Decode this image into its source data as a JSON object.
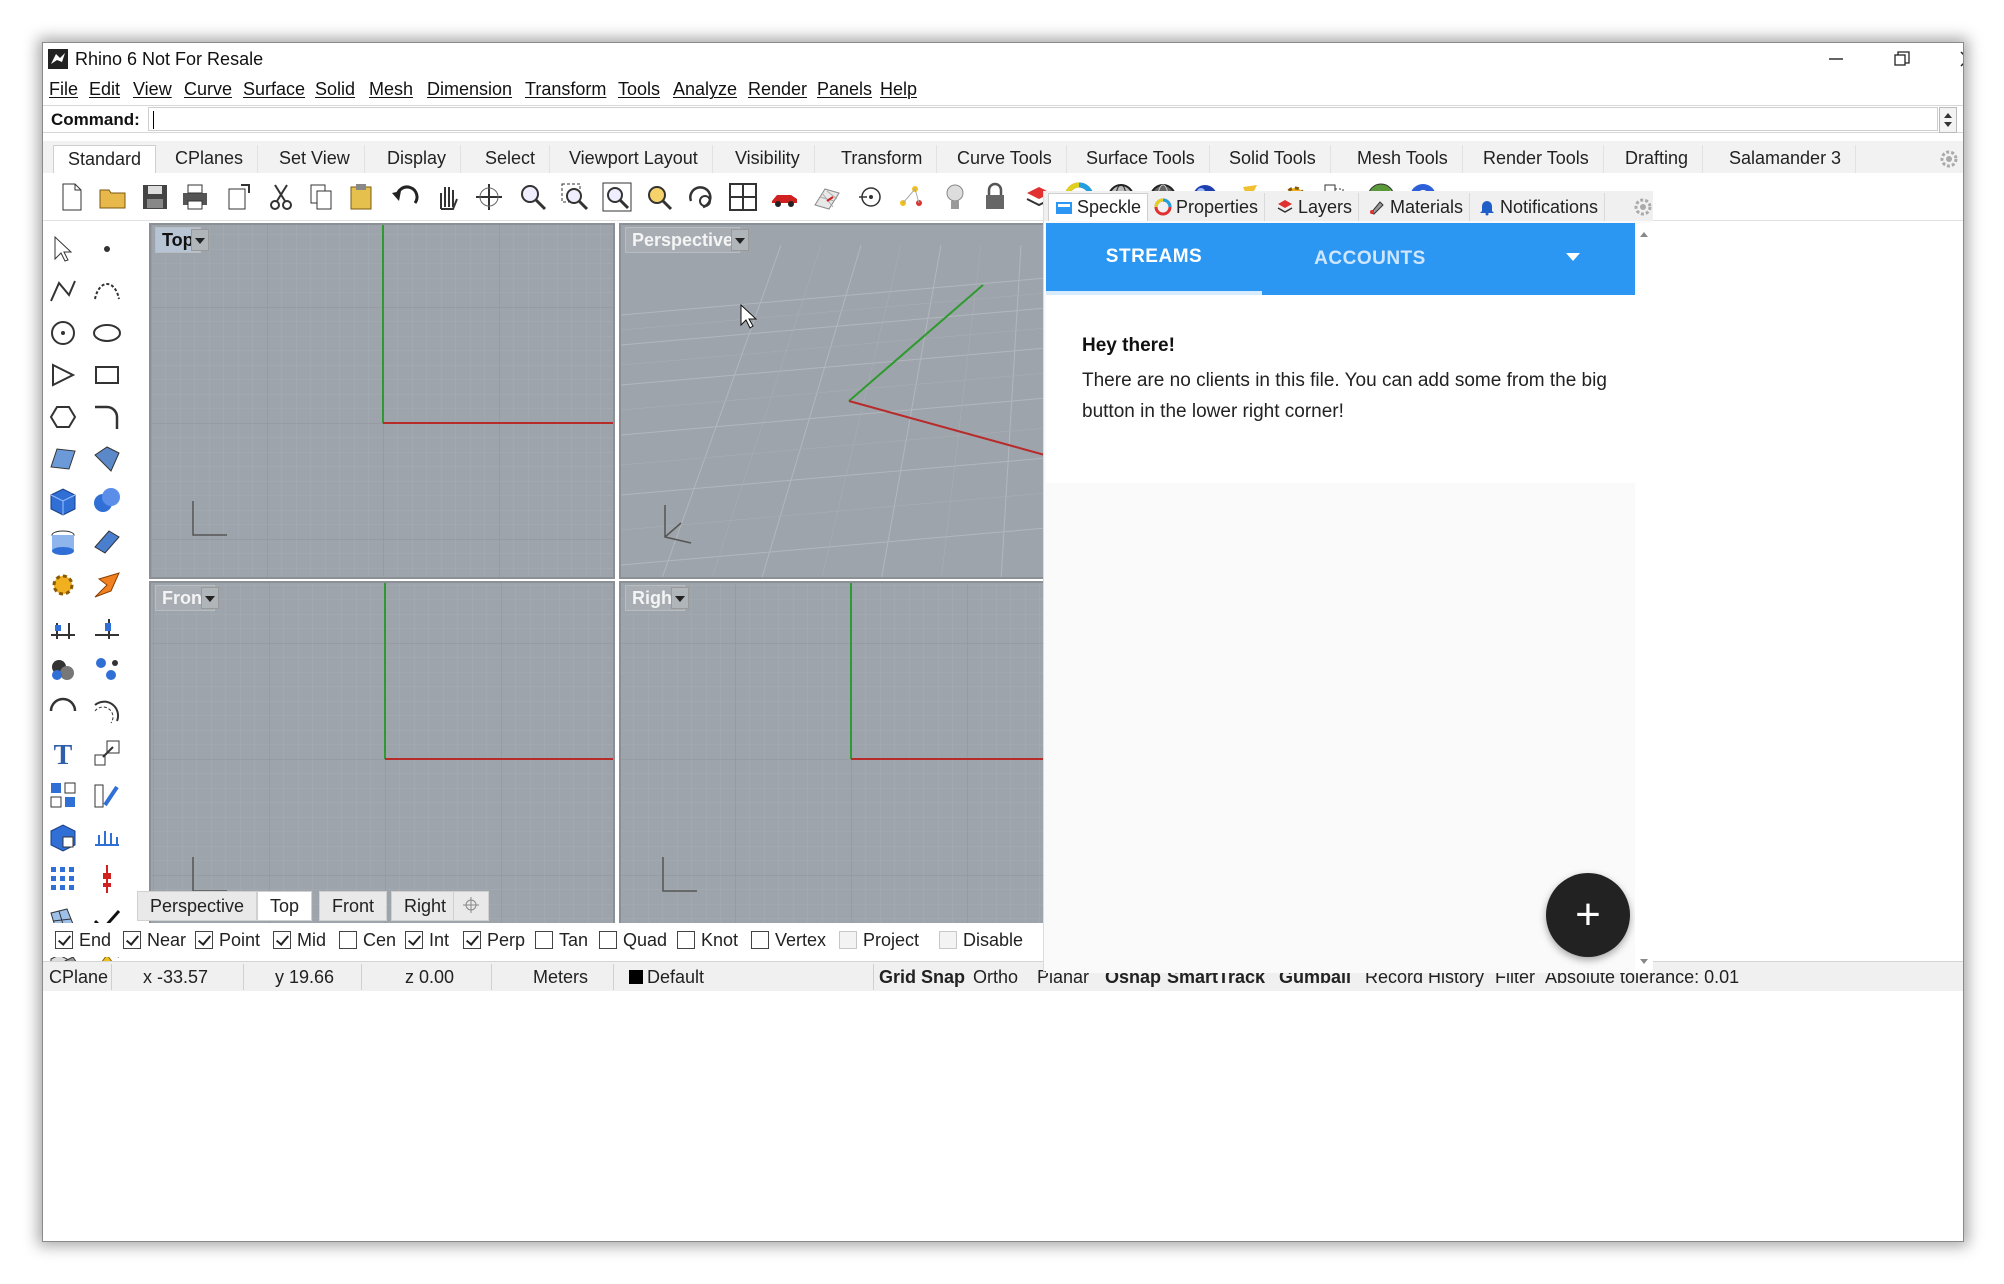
{
  "app": {
    "title": "Rhino 6 Not For Resale"
  },
  "menu": [
    "File",
    "Edit",
    "View",
    "Curve",
    "Surface",
    "Solid",
    "Mesh",
    "Dimension",
    "Transform",
    "Tools",
    "Analyze",
    "Render",
    "Panels",
    "Help"
  ],
  "command": {
    "label": "Command:",
    "value": ""
  },
  "toolbar_tabs": [
    "Standard",
    "CPlanes",
    "Set View",
    "Display",
    "Select",
    "Viewport Layout",
    "Visibility",
    "Transform",
    "Curve Tools",
    "Surface Tools",
    "Solid Tools",
    "Mesh Tools",
    "Render Tools",
    "Drafting",
    "Salamander 3"
  ],
  "toolbar_active_tab": "Standard",
  "toolbar_icons": [
    "new-file",
    "open",
    "save",
    "print",
    "import",
    "cut",
    "copy",
    "paste",
    "undo",
    "pan",
    "rotate-view",
    "zoom",
    "zoom-window",
    "zoom-extents",
    "zoom-selected",
    "reset-view",
    "four-viewports",
    "car",
    "grid",
    "snap-dot",
    "points",
    "light-bulb",
    "lock",
    "layer",
    "color-wheel",
    "wireframe-sphere",
    "shaded-sphere",
    "render-sphere",
    "flashlight",
    "gear",
    "grasshopper",
    "globe",
    "help"
  ],
  "viewports": {
    "top": {
      "label": "Top"
    },
    "perspective": {
      "label": "Perspective"
    },
    "front": {
      "label": "Front"
    },
    "right": {
      "label": "Right"
    }
  },
  "viewport_tabs": [
    "Perspective",
    "Top",
    "Front",
    "Right"
  ],
  "viewport_tabs_active": "Top",
  "osnap": [
    {
      "label": "End",
      "checked": true
    },
    {
      "label": "Near",
      "checked": true
    },
    {
      "label": "Point",
      "checked": true
    },
    {
      "label": "Mid",
      "checked": true
    },
    {
      "label": "Cen",
      "checked": false
    },
    {
      "label": "Int",
      "checked": true
    },
    {
      "label": "Perp",
      "checked": true
    },
    {
      "label": "Tan",
      "checked": false
    },
    {
      "label": "Quad",
      "checked": false
    },
    {
      "label": "Knot",
      "checked": false
    },
    {
      "label": "Vertex",
      "checked": false
    },
    {
      "label": "Project",
      "checked": false
    },
    {
      "label": "Disable",
      "checked": false
    }
  ],
  "status": {
    "cplane": "CPlane",
    "x": "x -33.57",
    "y": "y 19.66",
    "z": "z 0.00",
    "units": "Meters",
    "layer": "Default",
    "layer_color": "#000000",
    "toggles": [
      {
        "label": "Grid Snap",
        "bold": true
      },
      {
        "label": "Ortho",
        "bold": false
      },
      {
        "label": "Planar",
        "bold": false
      },
      {
        "label": "Osnap",
        "bold": true
      },
      {
        "label": "SmartTrack",
        "bold": true
      },
      {
        "label": "Gumball",
        "bold": true
      },
      {
        "label": "Record History",
        "bold": false
      },
      {
        "label": "Filter",
        "bold": false
      }
    ],
    "tolerance": "Absolute tolerance: 0.01"
  },
  "panel_tabs": [
    "Speckle",
    "Properties",
    "Layers",
    "Materials",
    "Notifications"
  ],
  "panel_active_tab": "Speckle",
  "speckle": {
    "tabs": [
      "STREAMS",
      "ACCOUNTS"
    ],
    "active_tab": "STREAMS",
    "heading": "Hey there!",
    "message": "There are no clients in this file. You can add some from the big button in the lower right corner!",
    "fab_label": "+",
    "accent": "#2b97f3"
  },
  "colors": {
    "viewport_bg": "#9ea4ab",
    "x_axis": "#b82b2b",
    "y_axis": "#2f9a2f"
  }
}
